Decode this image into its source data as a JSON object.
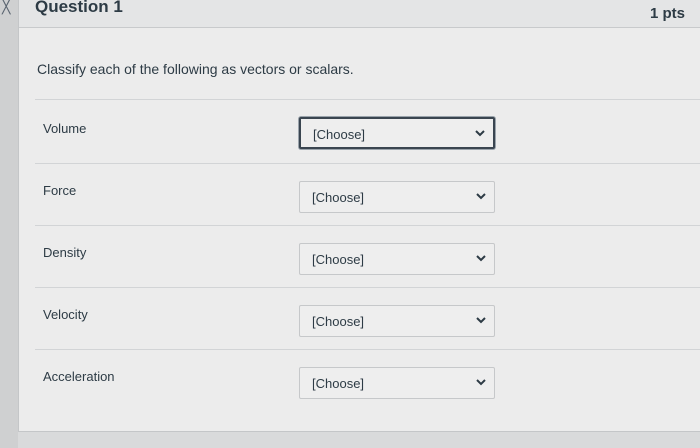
{
  "question": {
    "title": "Question 1",
    "points": "1 pts",
    "prompt": "Classify each of the following as vectors or scalars."
  },
  "rows": [
    {
      "label": "Volume",
      "selected": "[Choose]"
    },
    {
      "label": "Force",
      "selected": "[Choose]"
    },
    {
      "label": "Density",
      "selected": "[Choose]"
    },
    {
      "label": "Velocity",
      "selected": "[Choose]"
    },
    {
      "label": "Acceleration",
      "selected": "[Choose]"
    }
  ],
  "icons": {
    "dropdown": "chevron-down-icon"
  }
}
